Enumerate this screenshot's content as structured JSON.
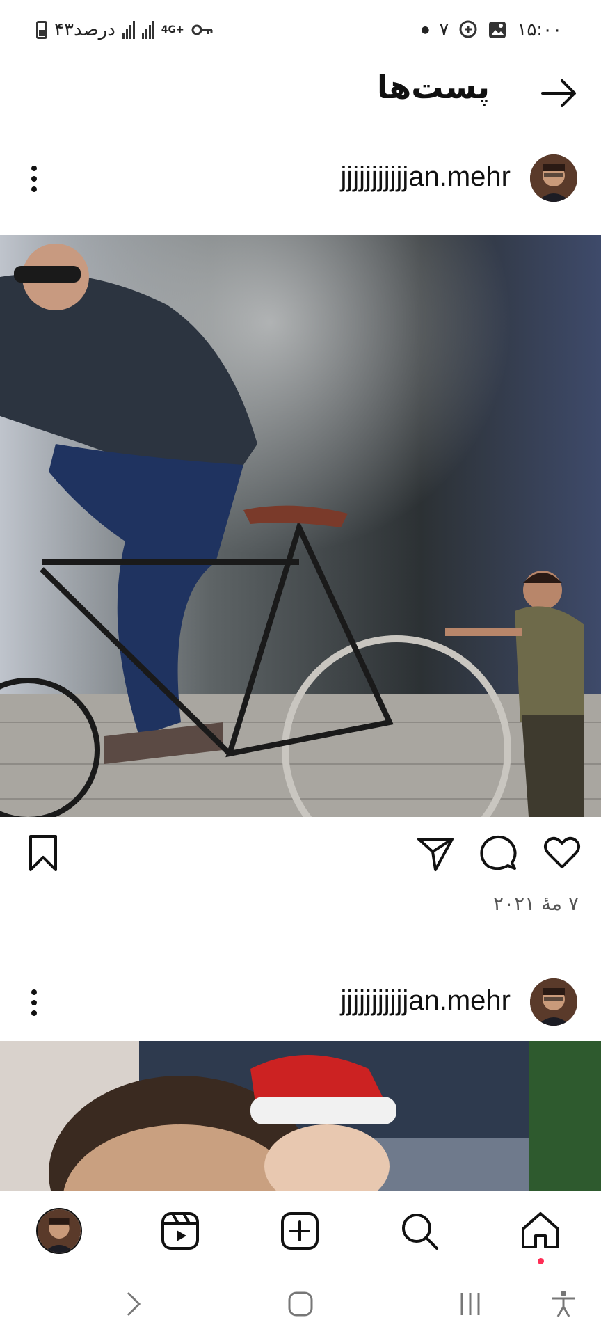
{
  "status_bar": {
    "time": "۱۵:۰۰",
    "battery": "۴۳درصد",
    "network": "4G+",
    "notification_count": "۷"
  },
  "header": {
    "title": "پست‌ها"
  },
  "posts": [
    {
      "username": "jjjjjjjjjjjan.mehr",
      "date": "۷ مهٔ ۲۰۲۱"
    },
    {
      "username": "jjjjjjjjjjjan.mehr"
    }
  ],
  "icons": {
    "back": "arrow-right-icon",
    "more": "more-vertical-icon",
    "like": "heart-icon",
    "comment": "comment-icon",
    "share": "send-icon",
    "save": "bookmark-icon",
    "nav_home": "home-icon",
    "nav_search": "search-icon",
    "nav_create": "add-post-icon",
    "nav_reels": "reels-icon",
    "nav_profile": "profile-avatar"
  },
  "colors": {
    "notification_dot": "#ff2d55",
    "text": "#111111"
  }
}
